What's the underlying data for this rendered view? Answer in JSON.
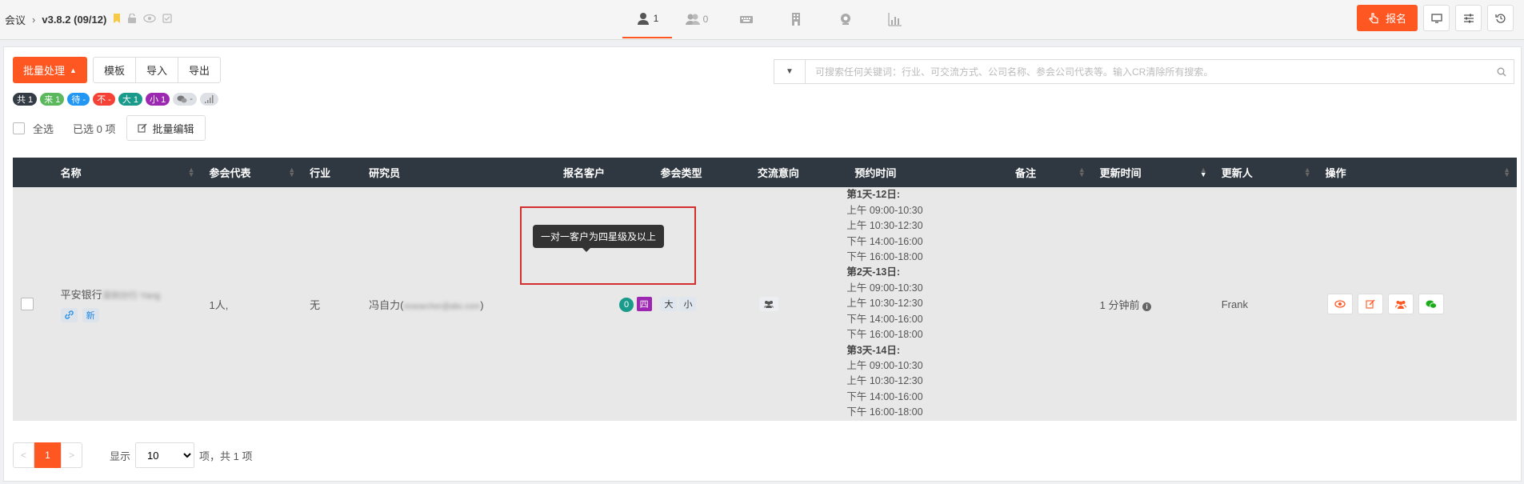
{
  "breadcrumb": {
    "root": "会议",
    "version": "v3.8.2 (09/12)"
  },
  "nav_tabs": [
    {
      "icon": "user-icon",
      "count": "1",
      "active": true
    },
    {
      "icon": "users-icon",
      "count": "0",
      "active": false
    },
    {
      "icon": "keyboard-icon",
      "count": "",
      "active": false
    },
    {
      "icon": "building-icon",
      "count": "",
      "active": false
    },
    {
      "icon": "webcam-icon",
      "count": "",
      "active": false
    },
    {
      "icon": "bar-chart-icon",
      "count": "",
      "active": false
    }
  ],
  "top_actions": {
    "signup_label": "报名"
  },
  "toolbar": {
    "batch_label": "批量处理",
    "template": "模板",
    "import": "导入",
    "export": "导出"
  },
  "search": {
    "placeholder": "可搜索任何关键词：行业、可交流方式、公司名称、参会公司代表等。输入CR清除所有搜索。"
  },
  "badges": [
    {
      "label": "共 1",
      "color": "#333b44"
    },
    {
      "label": "来 1",
      "color": "#5cb85c"
    },
    {
      "label": "待 -",
      "color": "#2196f3"
    },
    {
      "label": "不 -",
      "color": "#f44336"
    },
    {
      "label": "大 1",
      "color": "#1a9a8a"
    },
    {
      "label": "小 1",
      "color": "#9c27b0"
    }
  ],
  "selection": {
    "select_all": "全选",
    "selected_count": "已选 0 项",
    "batch_edit": "批量编辑"
  },
  "table": {
    "headers": [
      "名称",
      "参会代表",
      "行业",
      "研究员",
      "报名客户",
      "参会类型",
      "交流意向",
      "预约时间",
      "备注",
      "更新时间",
      "更新人",
      "操作"
    ],
    "row": {
      "name": "平安银行",
      "name_blurred": "深圳分行·Yang",
      "tag_new": "新",
      "rep": "1人,",
      "industry": "无",
      "researcher": "冯自力(",
      "researcher_blurred": "researcher@abc.com",
      "researcher_tail": ")",
      "client_count": "0",
      "star_level": "四",
      "type_big": "大",
      "type_small": "小",
      "schedule": [
        {
          "day": "第1天-12日:",
          "slots": [
            "上午 09:00-10:30",
            "上午 10:30-12:30",
            "下午 14:00-16:00",
            "下午 16:00-18:00"
          ]
        },
        {
          "day": "第2天-13日:",
          "slots": [
            "上午 09:00-10:30",
            "上午 10:30-12:30",
            "下午 14:00-16:00",
            "下午 16:00-18:00"
          ]
        },
        {
          "day": "第3天-14日:",
          "slots": [
            "上午 09:00-10:30",
            "上午 10:30-12:30",
            "下午 14:00-16:00",
            "下午 16:00-18:00"
          ]
        }
      ],
      "note": "",
      "updated": "1 分钟前",
      "updater": "Frank"
    }
  },
  "tooltip": "一对一客户为四星级及以上",
  "pagination": {
    "prev": "<",
    "current": "1",
    "next": ">",
    "show": "显示",
    "page_size": "10",
    "total": "项，共 1 项"
  },
  "colors": {
    "accent": "#ff5722",
    "header_bg": "#2f3740",
    "highlight_border": "#d32f2f"
  }
}
